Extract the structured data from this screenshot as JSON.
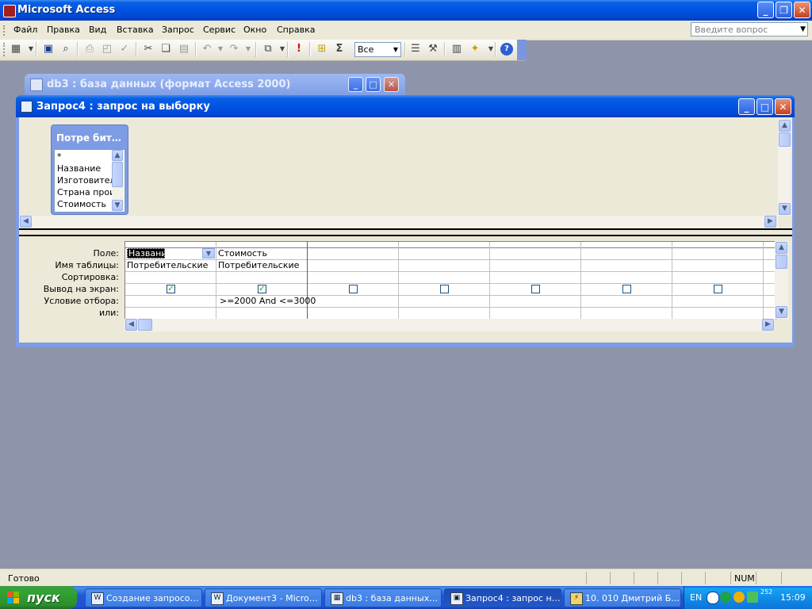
{
  "app": {
    "title": "Microsoft Access",
    "menu": [
      "Файл",
      "Правка",
      "Вид",
      "Вставка",
      "Запрос",
      "Сервис",
      "Окно",
      "Справка"
    ],
    "ask_placeholder": "Введите вопрос",
    "toolbar_combo_value": "Все"
  },
  "db_window": {
    "title": "db3 : база данных (формат Access 2000)"
  },
  "query_window": {
    "title": "Запрос4 : запрос на выборку",
    "field_list": {
      "title": "Потре бит…",
      "fields": [
        "*",
        "Название",
        "Изготовител",
        "Страна прои:",
        "Стоимость"
      ]
    },
    "grid_row_labels": [
      "Поле:",
      "Имя таблицы:",
      "Сортировка:",
      "Вывод на экран:",
      "Условие отбора:",
      "или:"
    ],
    "columns": [
      {
        "field": "Название",
        "table": "Потребительские",
        "show": true,
        "criteria": ""
      },
      {
        "field": "Стоимость",
        "table": "Потребительские",
        "show": true,
        "criteria": ">=2000 And <=3000"
      },
      {
        "field": "",
        "table": "",
        "show": false,
        "criteria": ""
      },
      {
        "field": "",
        "table": "",
        "show": false,
        "criteria": ""
      },
      {
        "field": "",
        "table": "",
        "show": false,
        "criteria": ""
      },
      {
        "field": "",
        "table": "",
        "show": false,
        "criteria": ""
      },
      {
        "field": "",
        "table": "",
        "show": false,
        "criteria": ""
      }
    ]
  },
  "status": {
    "text": "Готово",
    "num": "NUM"
  },
  "taskbar": {
    "start": "пуск",
    "tasks": [
      {
        "label": "Создание запросо…",
        "active": false
      },
      {
        "label": "Документ3 - Micro…",
        "active": false
      },
      {
        "label": "db3 : база данных…",
        "active": false
      },
      {
        "label": "Запрос4 : запрос н…",
        "active": true
      },
      {
        "label": "10. 010 Дмитрий Б…",
        "active": false
      }
    ],
    "lang": "EN",
    "tray_num": "252",
    "clock": "15:09"
  }
}
